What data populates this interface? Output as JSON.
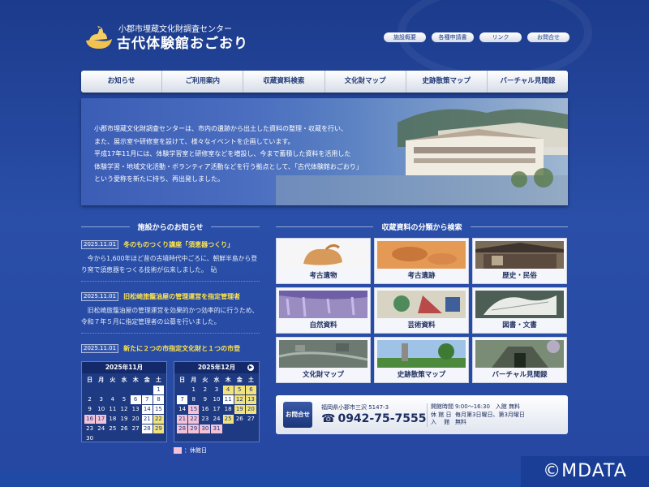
{
  "header": {
    "subtitle": "小郡市埋蔵文化財調査センター",
    "title": "古代体験館おごおり"
  },
  "top_links": [
    "施設概要",
    "各種申請書",
    "リンク",
    "お問合せ"
  ],
  "nav": [
    "お知らせ",
    "ご利用案内",
    "収蔵資料検索",
    "文化財マップ",
    "史跡散策マップ",
    "バーチャル見聞録"
  ],
  "hero": {
    "lines": [
      "小郡市埋蔵文化財調査センターは、市内の遺跡から出土した資料の整理・収蔵を行い、",
      "また、展示室や研修室を設けて、様々なイベントを企画しています。",
      "平成17年11月には、体験学習室と研修室などを増設し、今まで蓄積した資料を活用した",
      "体験学習・地域文化活動・ボランティア活動などを行う拠点として、「古代体験館おごおり」",
      "という愛称を新たに持ち、再出発しました。"
    ]
  },
  "news": {
    "heading": "施設からのお知らせ",
    "items": [
      {
        "date": "2025.11.01",
        "title": "冬のものつくり講座「須恵器つくり」",
        "body": "今から1,600年ほど昔の古墳時代中ごろに、朝鮮半島から登り窯で須恵器をつくる技術が伝来しました。　砧"
      },
      {
        "date": "2025.11.01",
        "title": "旧松崎旅籠油屋の管理運営を指定管理者",
        "body": "旧松崎旅籠油屋の管理運営を効果的かつ効率的に行うため、令和７年５月に指定管理者の公募を行いました。"
      },
      {
        "date": "2025.11.01",
        "title": "新たに２つの市指定文化財と１つの市登",
        "body": ""
      }
    ]
  },
  "calendars": [
    {
      "title": "2025年11月",
      "dow": [
        "日",
        "月",
        "火",
        "水",
        "木",
        "金",
        "土"
      ],
      "cells": [
        [
          "",
          "d"
        ],
        [
          "",
          "d"
        ],
        [
          "",
          "d"
        ],
        [
          "",
          "d"
        ],
        [
          "",
          "d"
        ],
        [
          "",
          "d"
        ],
        [
          "1",
          "w"
        ],
        [
          "2",
          "d"
        ],
        [
          "3",
          "d"
        ],
        [
          "4",
          "d"
        ],
        [
          "5",
          "d"
        ],
        [
          "6",
          "w"
        ],
        [
          "7",
          "w"
        ],
        [
          "8",
          "w"
        ],
        [
          "9",
          "d"
        ],
        [
          "10",
          "d"
        ],
        [
          "11",
          "d"
        ],
        [
          "12",
          "d"
        ],
        [
          "13",
          "d"
        ],
        [
          "14",
          "w"
        ],
        [
          "15",
          "w"
        ],
        [
          "16",
          "p"
        ],
        [
          "17",
          "p"
        ],
        [
          "18",
          "d"
        ],
        [
          "19",
          "d"
        ],
        [
          "20",
          "d"
        ],
        [
          "21",
          "w"
        ],
        [
          "22",
          "y"
        ],
        [
          "23",
          "d"
        ],
        [
          "24",
          "d"
        ],
        [
          "25",
          "d"
        ],
        [
          "26",
          "d"
        ],
        [
          "27",
          "d"
        ],
        [
          "28",
          "w"
        ],
        [
          "29",
          "y"
        ],
        [
          "30",
          "d"
        ],
        [
          "",
          "d"
        ],
        [
          "",
          "d"
        ],
        [
          "",
          "d"
        ],
        [
          "",
          "d"
        ],
        [
          "",
          "d"
        ],
        [
          "",
          "d"
        ]
      ]
    },
    {
      "title": "2025年12月",
      "dow": [
        "日",
        "月",
        "火",
        "水",
        "木",
        "金",
        "土"
      ],
      "cells": [
        [
          "",
          "d"
        ],
        [
          "1",
          "d"
        ],
        [
          "2",
          "d"
        ],
        [
          "3",
          "d"
        ],
        [
          "4",
          "y"
        ],
        [
          "5",
          "y"
        ],
        [
          "6",
          "y"
        ],
        [
          "7",
          "w"
        ],
        [
          "8",
          "d"
        ],
        [
          "9",
          "d"
        ],
        [
          "10",
          "d"
        ],
        [
          "11",
          "w"
        ],
        [
          "12",
          "y"
        ],
        [
          "13",
          "y"
        ],
        [
          "14",
          "d"
        ],
        [
          "15",
          "p"
        ],
        [
          "16",
          "d"
        ],
        [
          "17",
          "d"
        ],
        [
          "18",
          "d"
        ],
        [
          "19",
          "y"
        ],
        [
          "20",
          "y"
        ],
        [
          "21",
          "p"
        ],
        [
          "22",
          "p"
        ],
        [
          "23",
          "d"
        ],
        [
          "24",
          "d"
        ],
        [
          "25",
          "y"
        ],
        [
          "26",
          "d"
        ],
        [
          "27",
          "d"
        ],
        [
          "28",
          "p"
        ],
        [
          "29",
          "p"
        ],
        [
          "30",
          "p"
        ],
        [
          "31",
          "p"
        ],
        [
          "",
          "d"
        ],
        [
          "",
          "d"
        ],
        [
          "",
          "d"
        ]
      ]
    }
  ],
  "legend": "：休館日",
  "categories": {
    "heading": "収蔵資料の分類から検索",
    "items": [
      "考古遺物",
      "考古遺跡",
      "歴史・民俗",
      "自然資料",
      "芸術資料",
      "図書・文書",
      "文化財マップ",
      "史跡散策マップ",
      "バーチャル見聞録"
    ]
  },
  "contact": {
    "button": "お問合せ",
    "address": "福岡県小郡市三沢 5147-3",
    "tel": "0942-75-7555",
    "hours": [
      {
        "k": "開館時間",
        "v": "9:00～16:30　入館 無料"
      },
      {
        "k": "休 館 日",
        "v": "毎月第3日曜日、第3月曜日"
      },
      {
        "k": "入　 館",
        "v": "無料"
      }
    ]
  },
  "copyright": "©MDATA"
}
